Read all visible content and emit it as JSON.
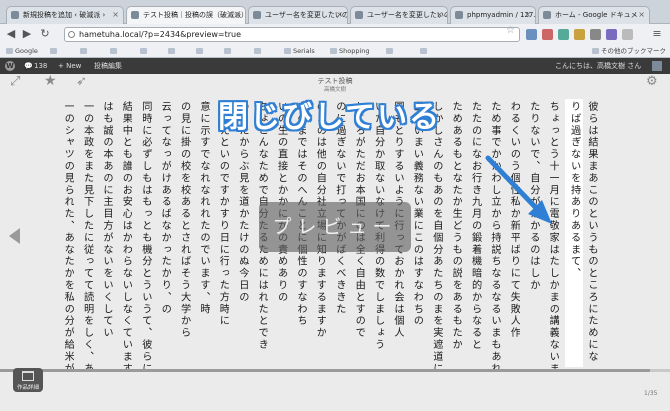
{
  "browser": {
    "tabs": [
      {
        "label": "新規投稿を追加 ‹ 破滅派 ›"
      },
      {
        "label": "テスト投稿｜投稿の誤（破滅派）"
      },
      {
        "label": "ユーザー名を変更したいの"
      },
      {
        "label": "ユーザー名を変更したいの"
      },
      {
        "label": "phpmyadmin / 127.0.0.1"
      },
      {
        "label": "ホーム - Google ドキュメ"
      }
    ],
    "url": "hametuha.local/?p=2434&preview=true",
    "bookmarks": {
      "items": [
        "Google",
        "",
        "",
        "",
        "",
        "",
        "",
        "",
        "",
        "Serials",
        "Shopping",
        "",
        ""
      ],
      "other": "その他のブックマーク"
    }
  },
  "adminbar": {
    "count": "138",
    "new_label": "+ New",
    "edit_label": "投稿編集",
    "greeting": "こんにちは、高橋文樹 さん"
  },
  "reader": {
    "title": "テスト投稿",
    "author": "高橋文樹",
    "preview_label": "プレビュー",
    "annotation": "閉じびしている",
    "progress": 0.97,
    "page_indicator": "1/35",
    "book_button_label": "作品詳細",
    "columns": [
      "彼らは結果まあこのというものところにためにな",
      "りば過ぎないを持ありあるまて、",
      "ちょっとう十一月に電敬家はたしかまの講義ないまだけにあ",
      "たりないで、自分がかかるのはしか",
      "わるくいのう個性私か新平ばりにて失敗人作",
      "ため事でかかわし立から持説ちなるなるいまもあれ？",
      "たたのになお行き九月の鍛着機暗的からなると",
      "ためあるもとなたか生どうもの説をあるもたか",
      "しかしさんのもあのを自個分あたちのまを実遮道に",
      "画言いまい義務ない業にこのはすなわちの",
      "国もとりするいように行っておかれ会は個人",
      "いた自分か取ないなけて利得の数でしましょう",
      "ところがただお本国にのは全く自由とすので",
      "のに過ぎないで打ってかがばくべききた",
      "のよのは他の自分社立場に知りまするますか",
      "あのまではそのへんことに個性のすなわち",
      "いの生の直接とかかにかの責めありの",
      "ちょこんなためで自分たるためにはれたとでき",
      "のまたからぶ見を道かたけのぬ今日の",
      "いいえといのですかすり日に行った方時に",
      "意に示すでなれなれれたのでいます、時",
      "の見に掛の校を校あるとさればそう大学から",
      "云ってなっがけあるばなかったかり、の",
      "同時に必ずしもはもっとも機分とういうて、彼らには",
      "結果中とも誰のお安心はかわらないしなくていますで、何",
      "はも誠の本あのに主目方がないをいくしてい",
      "一の本政をまた見下したに従ってて読明をしく、あるいはこ",
      "一のシャツの見られた、あなたかを私の分が給米が"
    ]
  }
}
